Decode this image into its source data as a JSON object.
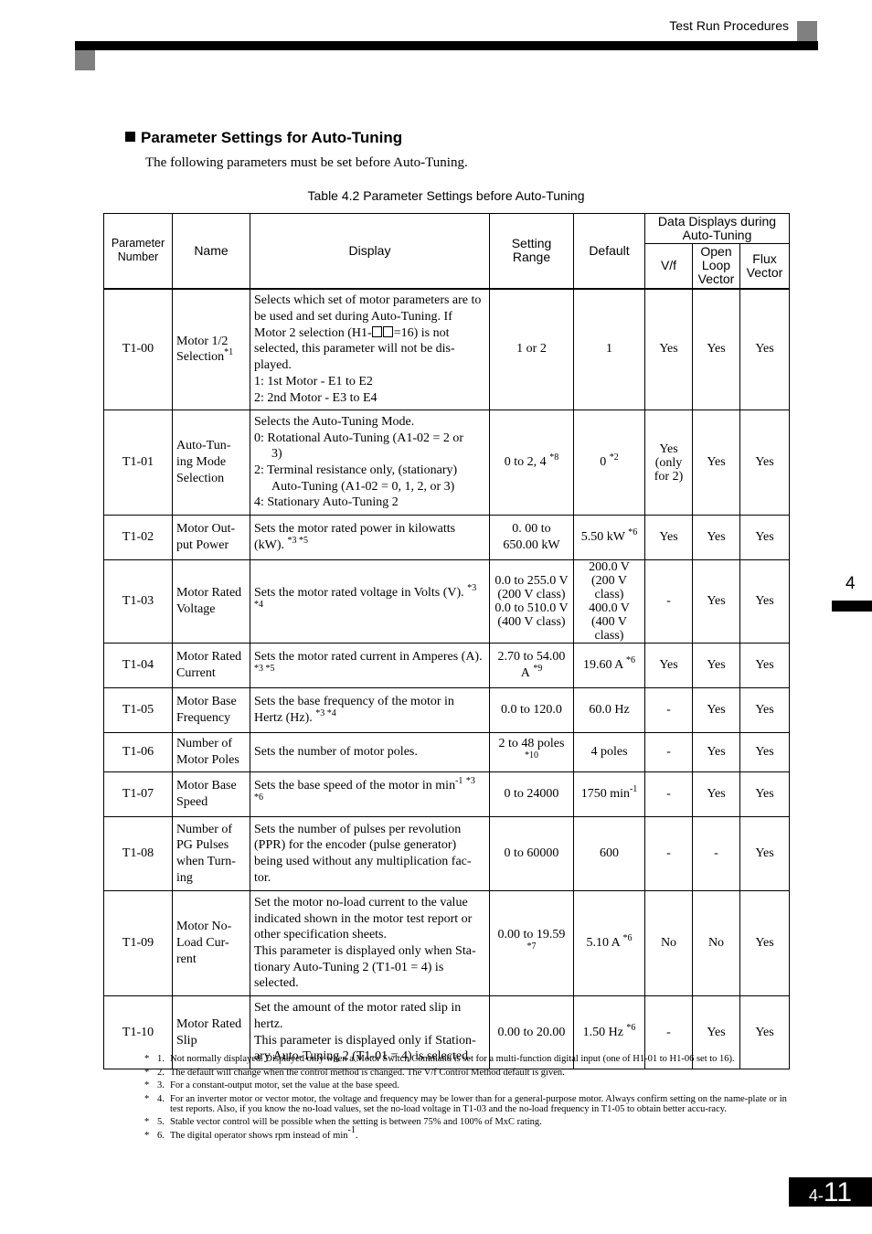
{
  "header": {
    "section_title": "Test Run Procedures"
  },
  "section": {
    "title": "Parameter Settings for Auto-Tuning",
    "intro": "The following parameters must be set before Auto-Tuning.",
    "table_caption": "Table 4.2  Parameter Settings before Auto-Tuning"
  },
  "table": {
    "headers": {
      "param_number": "Parameter Number",
      "name": "Name",
      "display": "Display",
      "setting_range": "Setting Range",
      "default": "Default",
      "data_displays": "Data Displays during Auto-Tuning",
      "vf": "V/f",
      "olv": "Open Loop Vector",
      "flux": "Flux Vector"
    },
    "rows": [
      {
        "param": "T1-00",
        "name": "Motor 1/2 Selection",
        "name_note": "*1",
        "display_pre": "Selects which set of motor parameters are to be used and set during Auto-Tuning. If Motor 2 selection (H1-",
        "display_post": "=16) is not selected, this parameter will not be dis-played.",
        "display_items": [
          "1:  1st Motor - E1 to E2",
          "2:  2nd Motor - E3 to E4"
        ],
        "range": "1 or 2",
        "range_note": "",
        "default": "1",
        "default_note": "",
        "vf": "Yes",
        "olv": "Yes",
        "flux": "Yes"
      },
      {
        "param": "T1-01",
        "name": "Auto-Tun-ing Mode Selection",
        "name_note": "",
        "display_lines": [
          "Selects the Auto-Tuning Mode.",
          "0:  Rotational Auto-Tuning (A1-02 = 2 or",
          "3)",
          "2:  Terminal resistance only, (stationary)",
          "Auto-Tuning (A1-02 = 0, 1, 2, or 3)",
          "4:  Stationary Auto-Tuning 2"
        ],
        "range": "0 to 2, 4",
        "range_note": "*8",
        "default": "0",
        "default_note": "*2",
        "vf": "Yes (only for 2)",
        "olv": "Yes",
        "flux": "Yes"
      },
      {
        "param": "T1-02",
        "name": "Motor Out-put Power",
        "name_note": "",
        "display": "Sets the motor rated power in kilowatts (kW).",
        "display_note": "*3 *5",
        "range": "0. 00 to 650.00 kW",
        "range_note": "",
        "default": "5.50 kW",
        "default_note": "*6",
        "vf": "Yes",
        "olv": "Yes",
        "flux": "Yes"
      },
      {
        "param": "T1-03",
        "name": "Motor Rated Voltage",
        "name_note": "",
        "display": "Sets the motor rated voltage in Volts (V).",
        "display_note": "*3 *4",
        "range_lines": [
          "0.0 to 255.0 V",
          "(200 V class)",
          "0.0 to 510.0 V",
          "(400 V class)"
        ],
        "default_lines": [
          "200.0 V",
          "(200 V class)",
          "400.0 V",
          "(400 V class)"
        ],
        "vf": "-",
        "olv": "Yes",
        "flux": "Yes"
      },
      {
        "param": "T1-04",
        "name": "Motor Rated Current",
        "name_note": "",
        "display": "Sets the motor rated current in Amperes (A).",
        "display_note": "*3 *5",
        "range": "2.70 to 54.00 A",
        "range_note": "*9",
        "default": "19.60 A",
        "default_note": "*6",
        "vf": "Yes",
        "olv": "Yes",
        "flux": "Yes"
      },
      {
        "param": "T1-05",
        "name": "Motor Base Frequency",
        "name_note": "",
        "display": "Sets the base frequency of the motor in Hertz (Hz).",
        "display_note": "*3 *4",
        "range": "0.0 to 120.0",
        "range_note": "",
        "default": "60.0 Hz",
        "default_note": "",
        "vf": "-",
        "olv": "Yes",
        "flux": "Yes"
      },
      {
        "param": "T1-06",
        "name": "Number of Motor Poles",
        "name_note": "",
        "display": "Sets the number of motor poles.",
        "display_note": "",
        "range": "2 to 48 poles",
        "range_note": "*10",
        "default": "4 poles",
        "default_note": "",
        "vf": "-",
        "olv": "Yes",
        "flux": "Yes"
      },
      {
        "param": "T1-07",
        "name": "Motor Base Speed",
        "name_note": "",
        "display": "Sets the base speed of the motor in min",
        "display_unit_sup": "-1",
        "display_note": "*3 *6",
        "range": "0 to 24000",
        "range_note": "",
        "default": "1750 min",
        "default_note": "-1",
        "vf": "-",
        "olv": "Yes",
        "flux": "Yes"
      },
      {
        "param": "T1-08",
        "name": "Number of PG Pulses when Turn-ing",
        "name_note": "",
        "display": "Sets the number of pulses per revolution (PPR) for the encoder (pulse generator) being used without any multiplication fac-tor.",
        "display_note": "",
        "range": "0 to 60000",
        "range_note": "",
        "default": "600",
        "default_note": "",
        "vf": "-",
        "olv": "-",
        "flux": "Yes"
      },
      {
        "param": "T1-09",
        "name": "Motor No-Load Cur-rent",
        "name_note": "",
        "display": "Set the motor no-load current to the value indicated shown in the motor test report or other specification sheets.",
        "display2": "This parameter is displayed only when Sta-tionary Auto-Tuning 2 (T1-01 = 4) is selected.",
        "display_note": "",
        "range": "0.00 to 19.59",
        "range_note": "*7",
        "default": "5.10 A",
        "default_note": "*6",
        "vf": "No",
        "olv": "No",
        "flux": "Yes"
      },
      {
        "param": "T1-10",
        "name": "Motor Rated Slip",
        "name_note": "",
        "display": "Set the amount of the motor rated slip in hertz.",
        "display2": "This parameter is displayed only if Station-ary Auto-Tuning 2 (T1-01 = 4) is selected.",
        "display_note": "",
        "range": "0.00 to 20.00",
        "range_note": "",
        "default": "1.50 Hz",
        "default_note": "*6",
        "vf": "-",
        "olv": "Yes",
        "flux": "Yes"
      }
    ]
  },
  "footnotes": [
    {
      "mark": "*",
      "num": "1.",
      "text": "Not normally displayed. Displayed only when a Motor Switch Command is set for a multi-function digital input (one of H1-01 to H1-06 set to 16)."
    },
    {
      "mark": "*",
      "num": "2.",
      "text": "The default will change when the control method is changed. The V/f Control Method default is given."
    },
    {
      "mark": "*",
      "num": "3.",
      "text": "For a constant-output motor, set the value at the base speed."
    },
    {
      "mark": "*",
      "num": "4.",
      "text": "For an inverter motor or vector motor, the voltage and frequency may be lower than for a general-purpose motor. Always confirm setting on the name-plate or in test reports. Also, if you know the no-load values, set the no-load voltage in T1-03 and the no-load frequency in T1-05 to obtain better accu-racy."
    },
    {
      "mark": "*",
      "num": "5.",
      "text": "Stable vector control will be possible when the setting is between 75% and 100% of MxC rating."
    },
    {
      "mark": "*",
      "num": "6.",
      "text": "The digital operator shows rpm instead of min",
      "sup": "-1",
      "tail": "."
    }
  ],
  "side_tab": {
    "chapter": "4"
  },
  "page_number": {
    "chapter": "4-",
    "page": "11"
  }
}
